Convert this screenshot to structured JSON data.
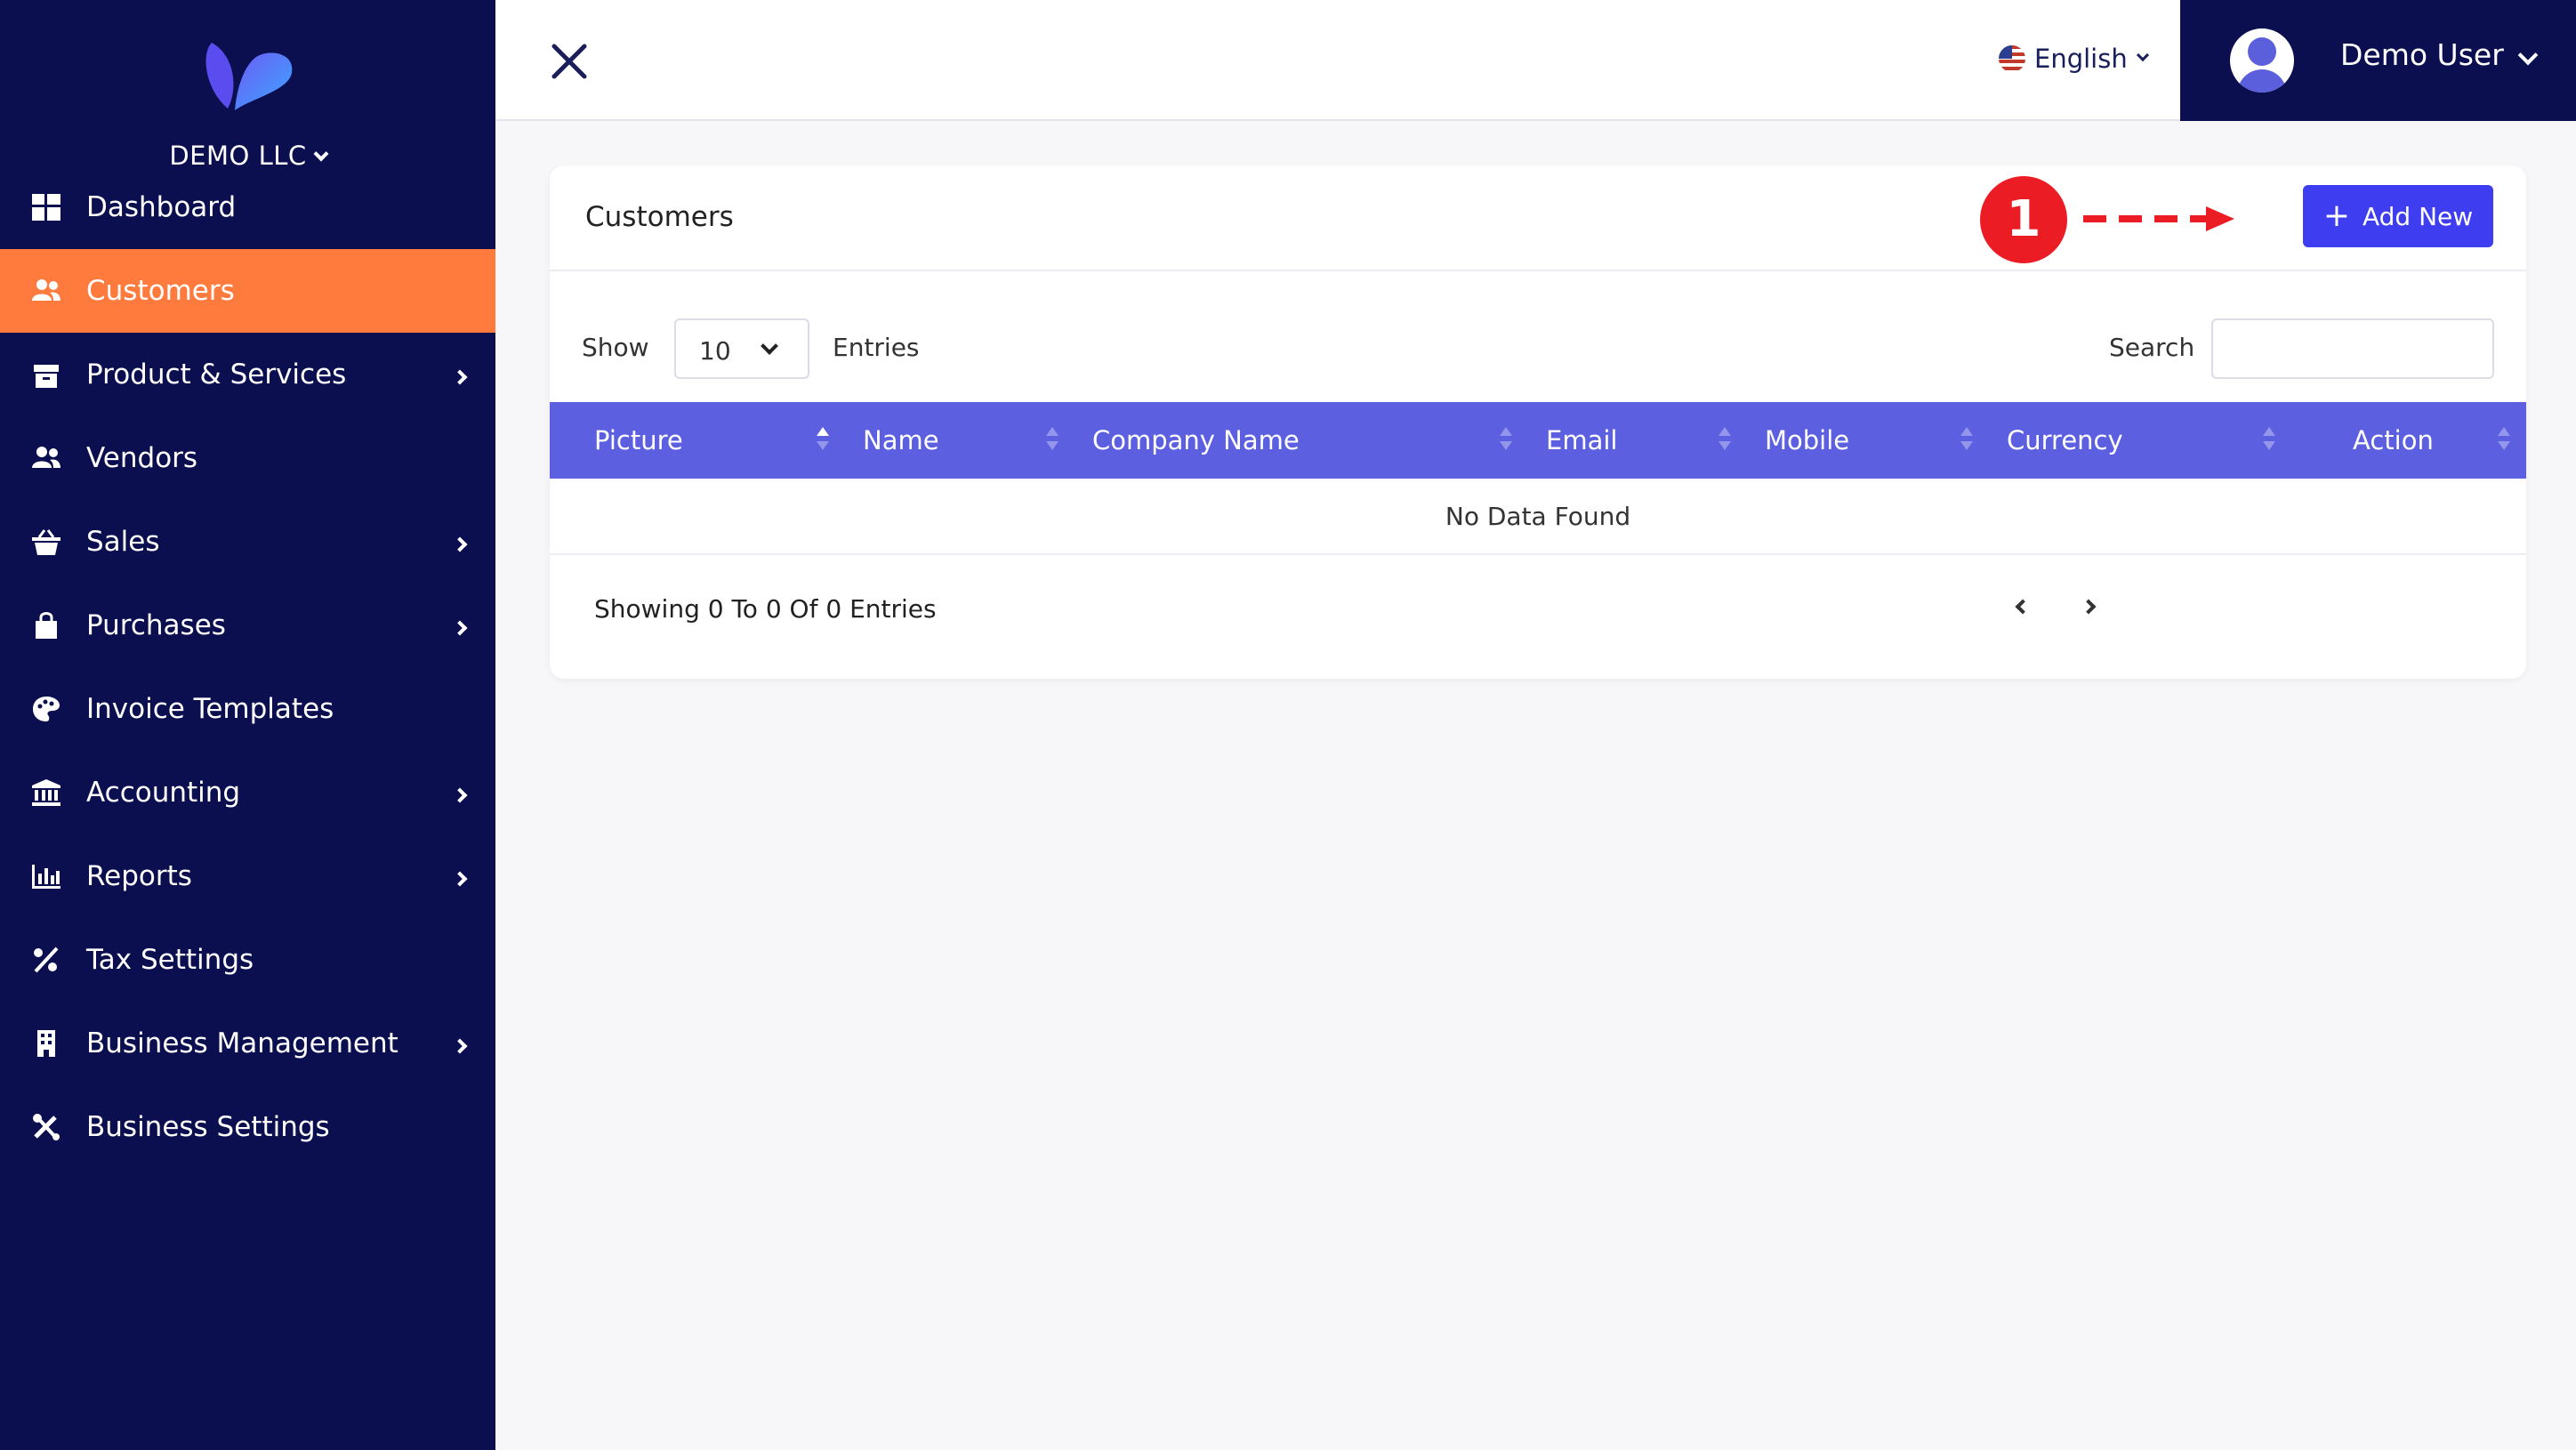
{
  "sidebar": {
    "company": "DEMO LLC",
    "items": [
      {
        "label": "Dashboard",
        "icon": "dashboard-icon"
      },
      {
        "label": "Customers",
        "icon": "users-icon"
      },
      {
        "label": "Product & Services",
        "icon": "box-icon"
      },
      {
        "label": "Vendors",
        "icon": "users-icon"
      },
      {
        "label": "Sales",
        "icon": "basket-icon"
      },
      {
        "label": "Purchases",
        "icon": "shopping-bag-icon"
      },
      {
        "label": "Invoice Templates",
        "icon": "palette-icon"
      },
      {
        "label": "Accounting",
        "icon": "bank-icon"
      },
      {
        "label": "Reports",
        "icon": "bar-chart-icon"
      },
      {
        "label": "Tax Settings",
        "icon": "percent-icon"
      },
      {
        "label": "Business Management",
        "icon": "building-icon"
      },
      {
        "label": "Business Settings",
        "icon": "tools-icon"
      }
    ]
  },
  "header": {
    "language": "English",
    "user_name": "Demo User"
  },
  "card": {
    "title": "Customers",
    "annotation_number": "1",
    "add_button": "Add New",
    "show_label": "Show",
    "entries_value": "10",
    "entries_label": "Entries",
    "search_label": "Search",
    "columns": [
      "Picture",
      "Name",
      "Company Name",
      "Email",
      "Mobile",
      "Currency",
      "Action"
    ],
    "empty_text": "No Data Found",
    "showing_text": "Showing 0 To 0 Of 0 Entries"
  },
  "colors": {
    "sidebar_bg": "#0b0f50",
    "active_item": "#ff7a3d",
    "table_header": "#5b5fe0",
    "primary_button": "#3e3ef0",
    "annotation_red": "#ec1c24"
  }
}
